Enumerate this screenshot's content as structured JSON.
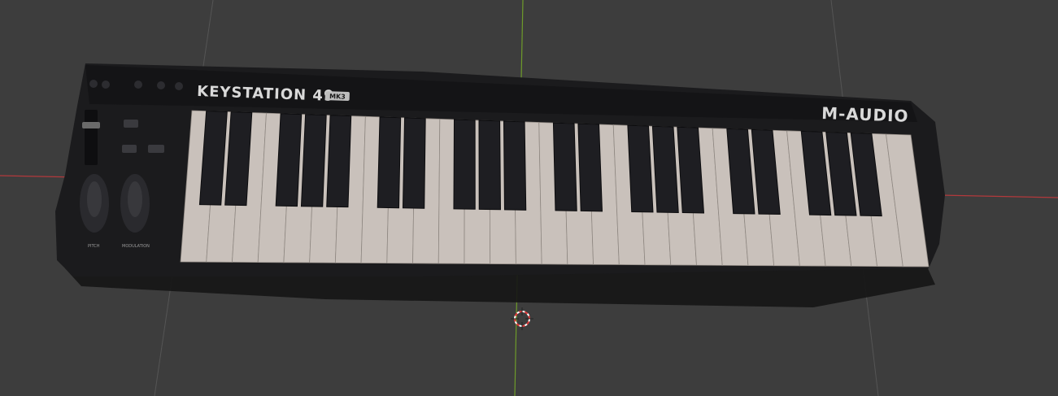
{
  "viewport": {
    "background": "#3d3d3d",
    "grid_line_color": "#555555",
    "x_axis_color": "#b3393c",
    "y_axis_color": "#6e9b2a",
    "cursor_colors": [
      "#e23a3a",
      "#ffffff"
    ]
  },
  "model": {
    "name": "3D scan of a MIDI keyboard controller",
    "brand_label": "KEYSTATION 49",
    "model_badge": "MK3",
    "manufacturer_label": "M-AUDIO",
    "wheel_labels": [
      "PITCH",
      "MODULATION"
    ],
    "white_key_count": 29,
    "body_color": "#1b1b1d",
    "white_key_color": "#c9c1bb",
    "black_key_color": "#1e1e22"
  },
  "icons": {
    "cursor": "3d-cursor-icon"
  }
}
